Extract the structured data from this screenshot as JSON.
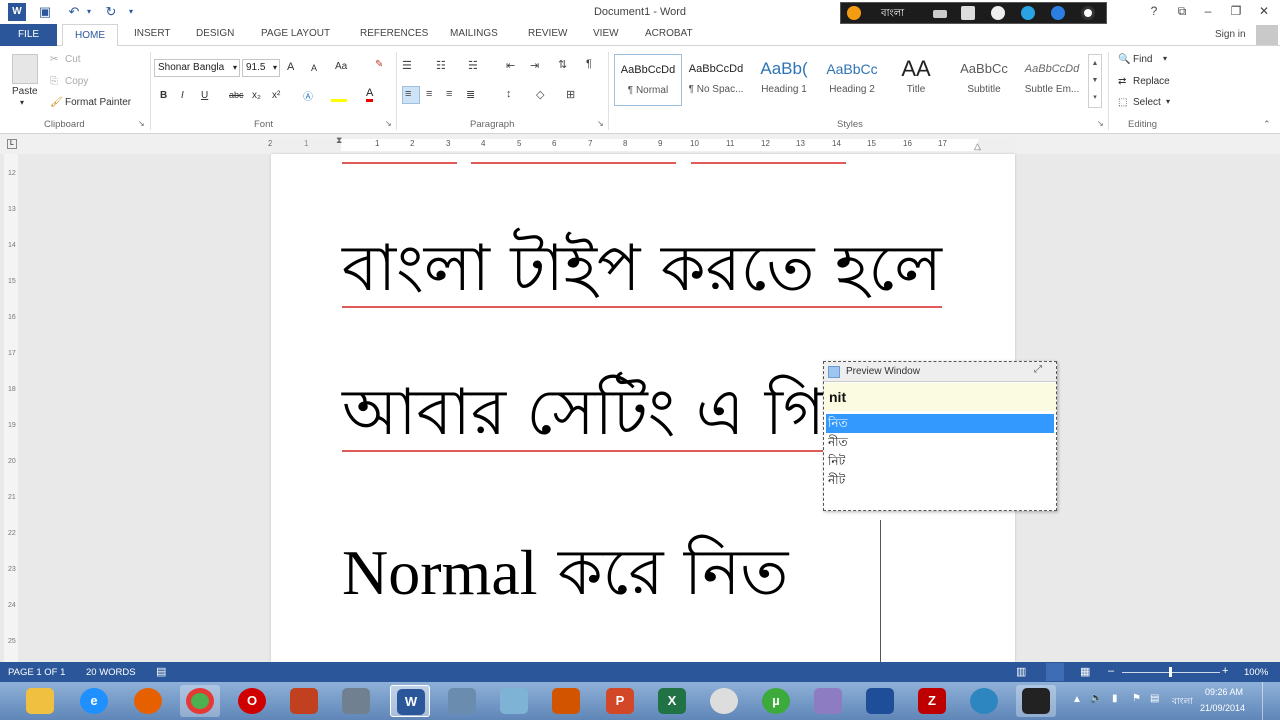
{
  "window": {
    "title": "Document1 - Word",
    "help": "?",
    "sign_in": "Sign in"
  },
  "language_bar": {
    "language": "বাংলা",
    "colors": {
      "bar": "#1c1c1c"
    }
  },
  "tabs": [
    "FILE",
    "HOME",
    "INSERT",
    "DESIGN",
    "PAGE LAYOUT",
    "REFERENCES",
    "MAILINGS",
    "REVIEW",
    "VIEW",
    "ACROBAT"
  ],
  "clipboard": {
    "paste": "Paste",
    "cut": "Cut",
    "copy": "Copy",
    "format_painter": "Format Painter",
    "label": "Clipboard"
  },
  "font": {
    "name": "Shonar Bangla",
    "size": "91.5",
    "grow": "A",
    "shrink": "A",
    "case": "Aa",
    "bold": "B",
    "italic": "I",
    "underline": "U",
    "strike": "abc",
    "subscript": "x₂",
    "superscript": "x²",
    "label": "Font"
  },
  "paragraph": {
    "label": "Paragraph"
  },
  "styles": {
    "label": "Styles",
    "items": [
      {
        "sample": "AaBbCcDd",
        "name": "¶ Normal"
      },
      {
        "sample": "AaBbCcDd",
        "name": "¶ No Spac..."
      },
      {
        "sample": "AaBb(",
        "name": "Heading 1"
      },
      {
        "sample": "AaBbCc",
        "name": "Heading 2"
      },
      {
        "sample": "AA",
        "name": "Title"
      },
      {
        "sample": "AaBbCc",
        "name": "Subtitle"
      },
      {
        "sample": "AaBbCcDd",
        "name": "Subtle Em..."
      }
    ]
  },
  "editing": {
    "find": "Find",
    "replace": "Replace",
    "select": "Select",
    "label": "Editing"
  },
  "ruler": {
    "numbers": [
      "2",
      "1",
      "1",
      "2",
      "3",
      "4",
      "5",
      "6",
      "7",
      "8",
      "9",
      "10",
      "11",
      "12",
      "13",
      "14",
      "15",
      "16",
      "17"
    ]
  },
  "vertical_ruler": {
    "numbers": [
      "12",
      "13",
      "14",
      "15",
      "16",
      "17",
      "18",
      "19",
      "20",
      "21",
      "22",
      "23",
      "24",
      "25"
    ]
  },
  "document": {
    "line1": "বাংলা টাইপ করতে হলে",
    "line2": "আবার সেটিং এ গি",
    "line3_latin": "Normal",
    "line3_bangla": "করে নিত"
  },
  "preview_window": {
    "title": "Preview Window",
    "input": "nit",
    "suggestions": [
      "নিত",
      "নীত",
      "নিট",
      "নীট"
    ],
    "selected_index": 0
  },
  "status": {
    "page": "PAGE 1 OF 1",
    "words": "20 WORDS",
    "zoom": "100%"
  },
  "tray": {
    "language": "বাংলা",
    "time": "09:26 AM",
    "date": "21/09/2014"
  },
  "taskbar_apps": [
    {
      "icon": "file-explorer-icon",
      "color": "#f0c040"
    },
    {
      "icon": "internet-explorer-icon",
      "color": "#1e90ff"
    },
    {
      "icon": "firefox-icon",
      "color": "#e66000"
    },
    {
      "icon": "chrome-icon",
      "color": "#4caf50"
    },
    {
      "icon": "opera-icon",
      "color": "#d00000"
    },
    {
      "icon": "paint-icon",
      "color": "#c04020"
    },
    {
      "icon": "calculator-icon",
      "color": "#708090"
    },
    {
      "icon": "word-icon",
      "color": "#2b579a"
    },
    {
      "icon": "tools-icon",
      "color": "#6a8caf"
    },
    {
      "icon": "notepad-icon",
      "color": "#7fb3d5"
    },
    {
      "icon": "app-icon",
      "color": "#d35400"
    },
    {
      "icon": "powerpoint-icon",
      "color": "#d24726"
    },
    {
      "icon": "excel-icon",
      "color": "#217346"
    },
    {
      "icon": "panda-icon",
      "color": "#dddddd"
    },
    {
      "icon": "utorrent-icon",
      "color": "#3cab3c"
    },
    {
      "icon": "feather-icon",
      "color": "#8e7cc3"
    },
    {
      "icon": "book-icon",
      "color": "#1f4e99"
    },
    {
      "icon": "filezilla-icon",
      "color": "#bf0000"
    },
    {
      "icon": "globe-icon",
      "color": "#2e86c1"
    },
    {
      "icon": "keyboard-icon",
      "color": "#222222"
    }
  ]
}
